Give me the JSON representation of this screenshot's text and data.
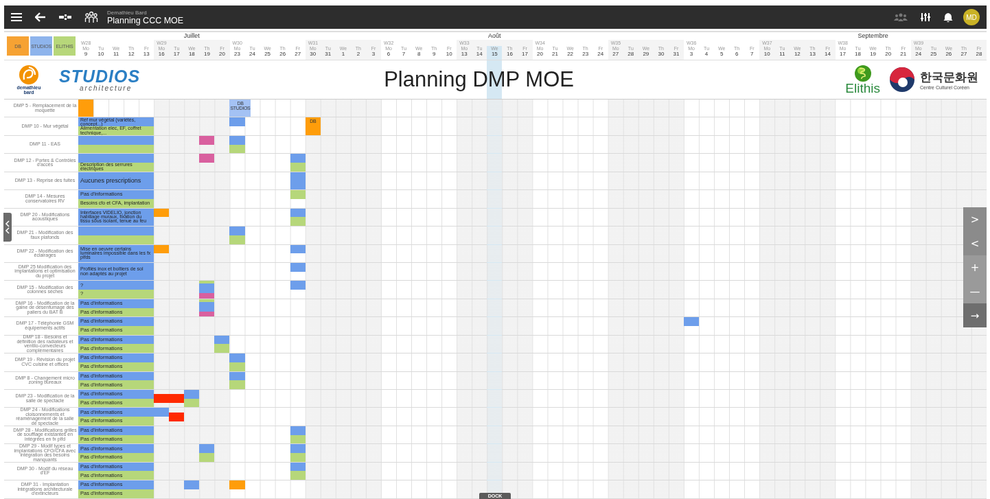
{
  "topbar": {
    "subtitle": "Demathieu Bard",
    "title": "Planning CCC MOE",
    "avatar": "MD"
  },
  "legend": [
    {
      "label": "DB",
      "color": "#f6a233"
    },
    {
      "label": "STUDIOS",
      "color": "#8eb4ec"
    },
    {
      "label": "ELITHIS",
      "color": "#b7d77a"
    }
  ],
  "weeks": [
    {
      "label": "W28",
      "days": [
        {
          "dow": "Mo",
          "num": "9",
          "today": false
        },
        {
          "dow": "Tu",
          "num": "10",
          "today": false
        },
        {
          "dow": "We",
          "num": "11",
          "today": false
        },
        {
          "dow": "Th",
          "num": "12",
          "today": false
        },
        {
          "dow": "Fr",
          "num": "13",
          "today": false
        }
      ]
    },
    {
      "label": "W29",
      "month": "Juillet",
      "days": [
        {
          "dow": "Mo",
          "num": "16",
          "today": false
        },
        {
          "dow": "Tu",
          "num": "17",
          "today": false
        },
        {
          "dow": "We",
          "num": "18",
          "today": false
        },
        {
          "dow": "Th",
          "num": "19",
          "today": false
        },
        {
          "dow": "Fr",
          "num": "20",
          "today": false
        }
      ]
    },
    {
      "label": "W30",
      "days": [
        {
          "dow": "Mo",
          "num": "23",
          "today": false
        },
        {
          "dow": "Tu",
          "num": "24",
          "today": false
        },
        {
          "dow": "We",
          "num": "25",
          "today": false
        },
        {
          "dow": "Th",
          "num": "26",
          "today": false
        },
        {
          "dow": "Fr",
          "num": "27",
          "today": false
        }
      ]
    },
    {
      "label": "W31",
      "days": [
        {
          "dow": "Mo",
          "num": "30",
          "today": false
        },
        {
          "dow": "Tu",
          "num": "31",
          "today": false
        },
        {
          "dow": "We",
          "num": "1",
          "today": false
        },
        {
          "dow": "Th",
          "num": "2",
          "today": false
        },
        {
          "dow": "Fr",
          "num": "3",
          "today": false
        }
      ]
    },
    {
      "label": "W32",
      "days": [
        {
          "dow": "Mo",
          "num": "6",
          "today": false
        },
        {
          "dow": "Tu",
          "num": "7",
          "today": false
        },
        {
          "dow": "We",
          "num": "8",
          "today": false
        },
        {
          "dow": "Th",
          "num": "9",
          "today": false
        },
        {
          "dow": "Fr",
          "num": "10",
          "today": false
        }
      ]
    },
    {
      "label": "W33",
      "month": "Août",
      "days": [
        {
          "dow": "Mo",
          "num": "13",
          "today": false
        },
        {
          "dow": "Tu",
          "num": "14",
          "today": false
        },
        {
          "dow": "We",
          "num": "15",
          "today": true
        },
        {
          "dow": "Th",
          "num": "16",
          "today": false
        },
        {
          "dow": "Fr",
          "num": "17",
          "today": false
        }
      ]
    },
    {
      "label": "W34",
      "days": [
        {
          "dow": "Mo",
          "num": "20",
          "today": false
        },
        {
          "dow": "Tu",
          "num": "21",
          "today": false
        },
        {
          "dow": "We",
          "num": "22",
          "today": false
        },
        {
          "dow": "Th",
          "num": "23",
          "today": false
        },
        {
          "dow": "Fr",
          "num": "24",
          "today": false
        }
      ]
    },
    {
      "label": "W35",
      "days": [
        {
          "dow": "Mo",
          "num": "27",
          "today": false
        },
        {
          "dow": "Tu",
          "num": "28",
          "today": false
        },
        {
          "dow": "We",
          "num": "29",
          "today": false
        },
        {
          "dow": "Th",
          "num": "30",
          "today": false
        },
        {
          "dow": "Fr",
          "num": "31",
          "today": false
        }
      ]
    },
    {
      "label": "W36",
      "days": [
        {
          "dow": "Mo",
          "num": "3",
          "today": false
        },
        {
          "dow": "Tu",
          "num": "4",
          "today": false
        },
        {
          "dow": "We",
          "num": "5",
          "today": false
        },
        {
          "dow": "Th",
          "num": "6",
          "today": false
        },
        {
          "dow": "Fr",
          "num": "7",
          "today": false
        }
      ]
    },
    {
      "label": "W37",
      "days": [
        {
          "dow": "Mo",
          "num": "10",
          "today": false
        },
        {
          "dow": "Tu",
          "num": "11",
          "today": false
        },
        {
          "dow": "We",
          "num": "12",
          "today": false
        },
        {
          "dow": "Th",
          "num": "13",
          "today": false
        },
        {
          "dow": "Fr",
          "num": "14",
          "today": false
        }
      ]
    },
    {
      "label": "W38",
      "month": "Septembre",
      "days": [
        {
          "dow": "Mo",
          "num": "17",
          "today": false
        },
        {
          "dow": "Tu",
          "num": "18",
          "today": false
        },
        {
          "dow": "We",
          "num": "19",
          "today": false
        },
        {
          "dow": "Th",
          "num": "20",
          "today": false
        },
        {
          "dow": "Fr",
          "num": "21",
          "today": false
        }
      ]
    },
    {
      "label": "W39",
      "days": [
        {
          "dow": "Mo",
          "num": "24",
          "today": false
        },
        {
          "dow": "Tu",
          "num": "25",
          "today": false
        },
        {
          "dow": "We",
          "num": "26",
          "today": false
        },
        {
          "dow": "Th",
          "num": "27",
          "today": false
        },
        {
          "dow": "Fr",
          "num": "28",
          "today": false
        }
      ]
    }
  ],
  "banner": {
    "company": [
      "demathieu",
      "bard"
    ],
    "studio": "STUDIOS",
    "studio_sub": "architecture",
    "title": "Planning DMP MOE",
    "elithis": "Elithis",
    "korean": "한국문화원",
    "korean_sub": "Centre Culturel Coréen"
  },
  "rows": [
    {
      "label": "DMP 5 - Remplacement de la moquette",
      "bars": [],
      "cells": [
        {
          "kind": "events",
          "blocks": [
            {
              "kind": "full",
              "color": "#ff9d0a"
            }
          ]
        },
        {
          "kind": "empty"
        },
        {
          "kind": "empty"
        },
        {
          "kind": "empty"
        },
        {
          "kind": "empty"
        },
        {
          "kind": "empty"
        },
        {
          "kind": "empty"
        },
        {
          "kind": "empty"
        },
        {
          "kind": "empty"
        },
        {
          "kind": "empty"
        },
        {
          "kind": "events",
          "blocks": [
            {
              "kind": "full",
              "color": "#a4c2f4",
              "text": "DB STUDIOS"
            }
          ]
        }
      ]
    },
    {
      "label": "DMP 10 - Mur végétal",
      "bars": [
        {
          "color": "#6d9eeb",
          "text": "Réf mur végétal (variétés, concept...)"
        },
        {
          "color": "#b6d77a",
          "text": "Alimentation elec, EF, coffret technique,..."
        }
      ],
      "cells": [
        {
          "kind": "empty"
        },
        {
          "kind": "empty"
        },
        {
          "kind": "empty"
        },
        {
          "kind": "empty"
        },
        {
          "kind": "empty"
        },
        {
          "kind": "empty"
        },
        {
          "kind": "empty"
        },
        {
          "kind": "empty"
        },
        {
          "kind": "empty"
        },
        {
          "kind": "empty"
        },
        {
          "kind": "events",
          "blocks": [
            {
              "kind": "top",
              "color": "#6d9eeb"
            }
          ]
        },
        {
          "kind": "empty"
        },
        {
          "kind": "empty"
        },
        {
          "kind": "empty"
        },
        {
          "kind": "empty"
        },
        {
          "kind": "events",
          "blocks": [
            {
              "kind": "full",
              "color": "#ff9d0a",
              "text": "DB"
            }
          ]
        }
      ]
    },
    {
      "label": "DMP 11 - EAS",
      "bars": [
        {
          "color": "#6d9eeb"
        },
        {
          "color": "#b6d77a"
        }
      ],
      "cells": [
        {
          "kind": "empty"
        },
        {
          "kind": "empty"
        },
        {
          "kind": "empty"
        },
        {
          "kind": "empty"
        },
        {
          "kind": "empty"
        },
        {
          "kind": "empty"
        },
        {
          "kind": "empty"
        },
        {
          "kind": "empty"
        },
        {
          "kind": "events",
          "blocks": [
            {
              "kind": "top",
              "color": "#d9609f"
            }
          ]
        },
        {
          "kind": "empty"
        },
        {
          "kind": "events",
          "blocks": [
            {
              "kind": "top",
              "color": "#6d9eeb"
            },
            {
              "kind": "bottom",
              "color": "#b6d77a"
            }
          ]
        }
      ]
    },
    {
      "label": "DMP 12 - Portes & Contrôles d'accès",
      "bars": [
        {
          "color": "#6d9eeb"
        },
        {
          "color": "#b6d77a",
          "text": "Description des serrures électriques"
        }
      ],
      "cells": [
        {
          "kind": "empty"
        },
        {
          "kind": "empty"
        },
        {
          "kind": "empty"
        },
        {
          "kind": "empty"
        },
        {
          "kind": "empty"
        },
        {
          "kind": "empty"
        },
        {
          "kind": "empty"
        },
        {
          "kind": "empty"
        },
        {
          "kind": "events",
          "blocks": [
            {
              "kind": "top",
              "color": "#d9609f"
            }
          ]
        },
        {
          "kind": "empty"
        },
        {
          "kind": "empty"
        },
        {
          "kind": "empty"
        },
        {
          "kind": "empty"
        },
        {
          "kind": "empty"
        },
        {
          "kind": "events",
          "blocks": [
            {
              "kind": "top",
              "color": "#6d9eeb"
            },
            {
              "kind": "bottom",
              "color": "#b6d77a"
            }
          ]
        }
      ]
    },
    {
      "label": "DMP 13 - Reprise des fuites",
      "bars": [
        {
          "color": "#6d9eeb",
          "text": "Aucunes prescriptions"
        }
      ],
      "cells": [
        {
          "kind": "empty"
        },
        {
          "kind": "empty"
        },
        {
          "kind": "empty"
        },
        {
          "kind": "empty"
        },
        {
          "kind": "empty"
        },
        {
          "kind": "empty"
        },
        {
          "kind": "empty"
        },
        {
          "kind": "empty"
        },
        {
          "kind": "empty"
        },
        {
          "kind": "empty"
        },
        {
          "kind": "empty"
        },
        {
          "kind": "empty"
        },
        {
          "kind": "empty"
        },
        {
          "kind": "empty"
        },
        {
          "kind": "events",
          "blocks": [
            {
              "kind": "full",
              "color": "#6d9eeb"
            }
          ]
        }
      ]
    },
    {
      "label": "DMP 14 - Mesures conservatoires RV",
      "bars": [
        {
          "color": "#6d9eeb",
          "text": "Pas d'informations"
        },
        {
          "color": "#b6d77a",
          "text": "Besoins cfo et CFA, implantation"
        }
      ],
      "cells": [
        {
          "kind": "empty"
        },
        {
          "kind": "empty"
        },
        {
          "kind": "empty"
        },
        {
          "kind": "empty"
        },
        {
          "kind": "empty"
        },
        {
          "kind": "empty"
        },
        {
          "kind": "empty"
        },
        {
          "kind": "empty"
        },
        {
          "kind": "empty"
        },
        {
          "kind": "empty"
        },
        {
          "kind": "empty"
        },
        {
          "kind": "empty"
        },
        {
          "kind": "empty"
        },
        {
          "kind": "empty"
        },
        {
          "kind": "events",
          "blocks": [
            {
              "kind": "top",
              "color": "#b6d77a"
            }
          ]
        }
      ]
    },
    {
      "label": "DMP 20 - Modifications acoustiques",
      "bars": [
        {
          "color": "#6d9eeb",
          "text": "Interfaces VIDELIO, jonction habillage muraux, fixation du tissu sous isolant, tenue au feu"
        }
      ],
      "cells": [
        {
          "kind": "empty"
        },
        {
          "kind": "empty"
        },
        {
          "kind": "empty"
        },
        {
          "kind": "empty"
        },
        {
          "kind": "empty"
        },
        {
          "kind": "events",
          "blocks": [
            {
              "kind": "top",
              "color": "#ff9d0a"
            }
          ]
        },
        {
          "kind": "empty"
        },
        {
          "kind": "empty"
        },
        {
          "kind": "empty"
        },
        {
          "kind": "empty"
        },
        {
          "kind": "empty"
        },
        {
          "kind": "empty"
        },
        {
          "kind": "empty"
        },
        {
          "kind": "empty"
        },
        {
          "kind": "events",
          "blocks": [
            {
              "kind": "top",
              "color": "#6d9eeb"
            },
            {
              "kind": "bottom",
              "color": "#b6d77a"
            }
          ]
        }
      ]
    },
    {
      "label": "DMP 21 - Modification des faux plafonds",
      "bars": [
        {
          "color": "#6d9eeb"
        },
        {
          "color": "#b6d77a"
        }
      ],
      "cells": [
        {
          "kind": "empty"
        },
        {
          "kind": "empty"
        },
        {
          "kind": "empty"
        },
        {
          "kind": "empty"
        },
        {
          "kind": "empty"
        },
        {
          "kind": "empty"
        },
        {
          "kind": "empty"
        },
        {
          "kind": "empty"
        },
        {
          "kind": "empty"
        },
        {
          "kind": "empty"
        },
        {
          "kind": "events",
          "blocks": [
            {
              "kind": "top",
              "color": "#6d9eeb"
            },
            {
              "kind": "bottom",
              "color": "#b6d77a"
            }
          ]
        }
      ]
    },
    {
      "label": "DMP 22 - Modification des éclairages",
      "bars": [
        {
          "color": "#6d9eeb",
          "text": "Mise en oeuvre certains luminaires impossible dans les fx plfds"
        }
      ],
      "cells": [
        {
          "kind": "empty"
        },
        {
          "kind": "empty"
        },
        {
          "kind": "empty"
        },
        {
          "kind": "empty"
        },
        {
          "kind": "empty"
        },
        {
          "kind": "events",
          "blocks": [
            {
              "kind": "top",
              "color": "#ff9d0a"
            }
          ]
        },
        {
          "kind": "empty"
        },
        {
          "kind": "empty"
        },
        {
          "kind": "empty"
        },
        {
          "kind": "empty"
        },
        {
          "kind": "empty"
        },
        {
          "kind": "empty"
        },
        {
          "kind": "empty"
        },
        {
          "kind": "empty"
        },
        {
          "kind": "events",
          "blocks": [
            {
              "kind": "top",
              "color": "#6d9eeb"
            }
          ]
        }
      ]
    },
    {
      "label": "DMP 25 Modification des implantations et optimisation du projet",
      "bars": [
        {
          "color": "#6d9eeb",
          "text": "Profilés inox et boîtiers de sol non adaptés au projet"
        }
      ],
      "cells": [
        {
          "kind": "empty"
        },
        {
          "kind": "empty"
        },
        {
          "kind": "empty"
        },
        {
          "kind": "empty"
        },
        {
          "kind": "empty"
        },
        {
          "kind": "empty"
        },
        {
          "kind": "empty"
        },
        {
          "kind": "empty"
        },
        {
          "kind": "empty"
        },
        {
          "kind": "empty"
        },
        {
          "kind": "empty"
        },
        {
          "kind": "empty"
        },
        {
          "kind": "empty"
        },
        {
          "kind": "empty"
        },
        {
          "kind": "events",
          "blocks": [
            {
              "kind": "top",
              "color": "#6d9eeb"
            }
          ]
        }
      ]
    },
    {
      "label": "DMP 15 - Modification des colonnes sèches",
      "bars": [
        {
          "color": "#6d9eeb",
          "text": "?"
        },
        {
          "color": "#b6d77a",
          "text": "?"
        }
      ],
      "cells": [
        {
          "kind": "empty"
        },
        {
          "kind": "empty"
        },
        {
          "kind": "empty"
        },
        {
          "kind": "empty"
        },
        {
          "kind": "empty"
        },
        {
          "kind": "empty"
        },
        {
          "kind": "empty"
        },
        {
          "kind": "empty"
        },
        {
          "kind": "events",
          "blocks": [
            {
              "kind": "strip-top",
              "color": "#b6d77a"
            },
            {
              "kind": "middle",
              "color": "#6d9eeb"
            },
            {
              "kind": "strip-bottom",
              "color": "#d9609f"
            }
          ]
        },
        {
          "kind": "empty"
        },
        {
          "kind": "empty"
        },
        {
          "kind": "empty"
        },
        {
          "kind": "empty"
        },
        {
          "kind": "empty"
        },
        {
          "kind": "events",
          "blocks": [
            {
              "kind": "top",
              "color": "#6d9eeb"
            }
          ]
        }
      ]
    },
    {
      "label": "DMP 16 - Modification de la gaine de désenfumage des paliers du BAT B",
      "bars": [
        {
          "color": "#6d9eeb",
          "text": "Pas d'informations"
        },
        {
          "color": "#b6d77a",
          "text": "Pas d'informations"
        }
      ],
      "cells": [
        {
          "kind": "empty"
        },
        {
          "kind": "empty"
        },
        {
          "kind": "empty"
        },
        {
          "kind": "empty"
        },
        {
          "kind": "empty"
        },
        {
          "kind": "empty"
        },
        {
          "kind": "empty"
        },
        {
          "kind": "empty"
        },
        {
          "kind": "events",
          "blocks": [
            {
              "kind": "strip-top",
              "color": "#b6d77a"
            },
            {
              "kind": "middle",
              "color": "#6d9eeb"
            },
            {
              "kind": "strip-bottom",
              "color": "#d9609f"
            }
          ]
        }
      ]
    },
    {
      "label": "DMP 17 - Téléphonie GSM équipements actifs",
      "bars": [
        {
          "color": "#6d9eeb",
          "text": "Pas d'informations"
        },
        {
          "color": "#b6d77a",
          "text": "Pas d'informations"
        }
      ],
      "cells": [
        {
          "kind": "empty"
        },
        {
          "kind": "empty"
        },
        {
          "kind": "empty"
        },
        {
          "kind": "empty"
        },
        {
          "kind": "empty"
        },
        {
          "kind": "empty"
        },
        {
          "kind": "empty"
        },
        {
          "kind": "empty"
        },
        {
          "kind": "empty"
        },
        {
          "kind": "empty"
        },
        {
          "kind": "empty"
        },
        {
          "kind": "empty"
        },
        {
          "kind": "empty"
        },
        {
          "kind": "empty"
        },
        {
          "kind": "empty"
        },
        {
          "kind": "empty"
        },
        {
          "kind": "empty"
        },
        {
          "kind": "empty"
        },
        {
          "kind": "empty"
        },
        {
          "kind": "empty"
        },
        {
          "kind": "empty"
        },
        {
          "kind": "empty"
        },
        {
          "kind": "empty"
        },
        {
          "kind": "empty"
        },
        {
          "kind": "empty"
        },
        {
          "kind": "empty"
        },
        {
          "kind": "empty"
        },
        {
          "kind": "empty"
        },
        {
          "kind": "empty"
        },
        {
          "kind": "empty"
        },
        {
          "kind": "empty"
        },
        {
          "kind": "empty"
        },
        {
          "kind": "empty"
        },
        {
          "kind": "empty"
        },
        {
          "kind": "empty"
        },
        {
          "kind": "empty"
        },
        {
          "kind": "empty"
        },
        {
          "kind": "empty"
        },
        {
          "kind": "empty"
        },
        {
          "kind": "empty"
        },
        {
          "kind": "events",
          "blocks": [
            {
              "kind": "top",
              "color": "#6d9eeb"
            }
          ]
        }
      ]
    },
    {
      "label": "DMP 18 - Besoins et définition des radiateurs et ventilo-convecteurs complémentaires",
      "bars": [
        {
          "color": "#6d9eeb",
          "text": "Pas d'informations"
        },
        {
          "color": "#b6d77a",
          "text": "Pas d'informations"
        }
      ],
      "cells": [
        {
          "kind": "empty"
        },
        {
          "kind": "empty"
        },
        {
          "kind": "empty"
        },
        {
          "kind": "empty"
        },
        {
          "kind": "empty"
        },
        {
          "kind": "empty"
        },
        {
          "kind": "empty"
        },
        {
          "kind": "empty"
        },
        {
          "kind": "empty"
        },
        {
          "kind": "events",
          "blocks": [
            {
              "kind": "top",
              "color": "#6d9eeb"
            },
            {
              "kind": "bottom",
              "color": "#b6d77a"
            }
          ]
        }
      ]
    },
    {
      "label": "DMP 19 - Révision du projet CVC cuisine et offices",
      "bars": [
        {
          "color": "#6d9eeb",
          "text": "Pas d'informations"
        },
        {
          "color": "#b6d77a",
          "text": "Pas d'informations"
        }
      ],
      "cells": [
        {
          "kind": "empty"
        },
        {
          "kind": "empty"
        },
        {
          "kind": "empty"
        },
        {
          "kind": "empty"
        },
        {
          "kind": "empty"
        },
        {
          "kind": "empty"
        },
        {
          "kind": "empty"
        },
        {
          "kind": "empty"
        },
        {
          "kind": "empty"
        },
        {
          "kind": "empty"
        },
        {
          "kind": "events",
          "blocks": [
            {
              "kind": "top",
              "color": "#6d9eeb"
            },
            {
              "kind": "bottom",
              "color": "#b6d77a"
            }
          ]
        }
      ]
    },
    {
      "label": "DMP 8 - Changement micro zoning bureaux",
      "bars": [
        {
          "color": "#6d9eeb",
          "text": "Pas d'informations"
        },
        {
          "color": "#b6d77a",
          "text": "Pas d'informations"
        }
      ],
      "cells": [
        {
          "kind": "empty"
        },
        {
          "kind": "empty"
        },
        {
          "kind": "empty"
        },
        {
          "kind": "empty"
        },
        {
          "kind": "empty"
        },
        {
          "kind": "empty"
        },
        {
          "kind": "empty"
        },
        {
          "kind": "empty"
        },
        {
          "kind": "empty"
        },
        {
          "kind": "empty"
        },
        {
          "kind": "events",
          "blocks": [
            {
              "kind": "top",
              "color": "#6d9eeb"
            },
            {
              "kind": "bottom",
              "color": "#b6d77a"
            }
          ]
        }
      ]
    },
    {
      "label": "DMP 23 - Modification de la salle de spectacle",
      "bars": [
        {
          "color": "#6d9eeb",
          "text": "Pas d'informations"
        },
        {
          "color": "#b6d77a",
          "text": "Pas d'informations"
        }
      ],
      "cells": [
        {
          "kind": "empty"
        },
        {
          "kind": "empty"
        },
        {
          "kind": "empty"
        },
        {
          "kind": "empty"
        },
        {
          "kind": "empty"
        },
        {
          "kind": "events",
          "blocks": [
            {
              "kind": "center",
              "color": "#ff2a00"
            }
          ]
        },
        {
          "kind": "events",
          "blocks": [
            {
              "kind": "center",
              "color": "#ff2a00"
            }
          ]
        },
        {
          "kind": "events",
          "blocks": [
            {
              "kind": "top",
              "color": "#6d9eeb"
            },
            {
              "kind": "bottom",
              "color": "#b6d77a"
            }
          ]
        }
      ]
    },
    {
      "label": "DMP 24 - Modifications cloisonnements et réaménagement de la salle de spectacle",
      "bars": [
        {
          "color": "#6d9eeb",
          "text": "Pas d'informations"
        },
        {
          "color": "#b6d77a",
          "text": "Pas d'informations"
        }
      ],
      "cells": [
        {
          "kind": "empty"
        },
        {
          "kind": "empty"
        },
        {
          "kind": "empty"
        },
        {
          "kind": "empty"
        },
        {
          "kind": "empty"
        },
        {
          "kind": "events",
          "blocks": [
            {
              "kind": "top",
              "color": "#6d9eeb"
            }
          ]
        },
        {
          "kind": "events",
          "blocks": [
            {
              "kind": "center",
              "color": "#ff2a00"
            }
          ]
        }
      ]
    },
    {
      "label": "DMP 28 - Modifications grilles de soufflage existantes en intégrées en fx plfd",
      "bars": [
        {
          "color": "#6d9eeb",
          "text": "Pas d'informations"
        },
        {
          "color": "#b6d77a",
          "text": "Pas d'informations"
        }
      ],
      "cells": [
        {
          "kind": "empty"
        },
        {
          "kind": "empty"
        },
        {
          "kind": "empty"
        },
        {
          "kind": "empty"
        },
        {
          "kind": "empty"
        },
        {
          "kind": "empty"
        },
        {
          "kind": "empty"
        },
        {
          "kind": "empty"
        },
        {
          "kind": "empty"
        },
        {
          "kind": "empty"
        },
        {
          "kind": "empty"
        },
        {
          "kind": "empty"
        },
        {
          "kind": "empty"
        },
        {
          "kind": "empty"
        },
        {
          "kind": "events",
          "blocks": [
            {
              "kind": "top",
              "color": "#6d9eeb"
            },
            {
              "kind": "bottom",
              "color": "#b6d77a"
            }
          ]
        }
      ]
    },
    {
      "label": "DMP 29 - Modif types et implantations CFO/CFA avec intégration des besoins manquants",
      "bars": [
        {
          "color": "#6d9eeb",
          "text": "Pas d'informations"
        },
        {
          "color": "#b6d77a",
          "text": "Pas d'informations"
        }
      ],
      "cells": [
        {
          "kind": "empty"
        },
        {
          "kind": "empty"
        },
        {
          "kind": "empty"
        },
        {
          "kind": "empty"
        },
        {
          "kind": "empty"
        },
        {
          "kind": "empty"
        },
        {
          "kind": "empty"
        },
        {
          "kind": "empty"
        },
        {
          "kind": "events",
          "blocks": [
            {
              "kind": "top",
              "color": "#6d9eeb"
            },
            {
              "kind": "bottom",
              "color": "#b6d77a"
            }
          ]
        },
        {
          "kind": "empty"
        },
        {
          "kind": "empty"
        },
        {
          "kind": "empty"
        },
        {
          "kind": "empty"
        },
        {
          "kind": "empty"
        },
        {
          "kind": "events",
          "blocks": [
            {
              "kind": "top",
              "color": "#6d9eeb"
            },
            {
              "kind": "bottom",
              "color": "#b6d77a"
            }
          ]
        }
      ]
    },
    {
      "label": "DMP 30 - Modif du réseau d'EF",
      "bars": [
        {
          "color": "#6d9eeb",
          "text": "Pas d'informations"
        },
        {
          "color": "#b6d77a",
          "text": "Pas d'informations"
        }
      ],
      "cells": [
        {
          "kind": "empty"
        },
        {
          "kind": "empty"
        },
        {
          "kind": "empty"
        },
        {
          "kind": "empty"
        },
        {
          "kind": "empty"
        },
        {
          "kind": "empty"
        },
        {
          "kind": "empty"
        },
        {
          "kind": "empty"
        },
        {
          "kind": "empty"
        },
        {
          "kind": "empty"
        },
        {
          "kind": "empty"
        },
        {
          "kind": "empty"
        },
        {
          "kind": "empty"
        },
        {
          "kind": "empty"
        },
        {
          "kind": "events",
          "blocks": [
            {
              "kind": "top",
              "color": "#6d9eeb"
            },
            {
              "kind": "bottom",
              "color": "#b6d77a"
            }
          ]
        }
      ]
    },
    {
      "label": "DMP 31 - Implantation intégrations architecturale d'extincteurs",
      "bars": [
        {
          "color": "#6d9eeb",
          "text": "Pas d'informations"
        },
        {
          "color": "#b6d77a",
          "text": "Pas d'informations"
        }
      ],
      "cells": [
        {
          "kind": "empty"
        },
        {
          "kind": "empty"
        },
        {
          "kind": "empty"
        },
        {
          "kind": "empty"
        },
        {
          "kind": "empty"
        },
        {
          "kind": "empty"
        },
        {
          "kind": "empty"
        },
        {
          "kind": "events",
          "blocks": [
            {
              "kind": "top",
              "color": "#6d9eeb"
            }
          ]
        },
        {
          "kind": "empty"
        },
        {
          "kind": "empty"
        },
        {
          "kind": "events",
          "blocks": [
            {
              "kind": "top",
              "color": "#ff9d0a"
            }
          ]
        }
      ]
    }
  ],
  "controls": [
    {
      "label": ">",
      "kind": "nav"
    },
    {
      "label": "<",
      "kind": "nav"
    },
    {
      "label": "+",
      "kind": "zoom"
    },
    {
      "label": "—",
      "kind": "zoom"
    },
    {
      "label": "→",
      "kind": "go"
    }
  ],
  "dock": "DOCK"
}
